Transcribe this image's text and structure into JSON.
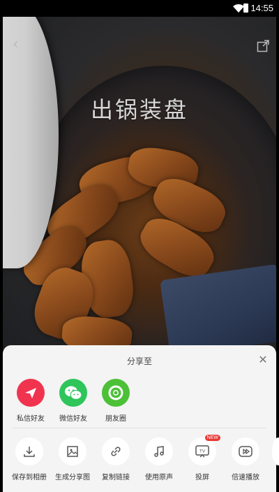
{
  "status_bar": {
    "time": "14:55"
  },
  "video": {
    "caption": "出锅装盘"
  },
  "share_sheet": {
    "title": "分享至",
    "share_targets": [
      {
        "label": "私信好友",
        "icon": "paper-plane-icon",
        "color": "#f0344f"
      },
      {
        "label": "微信好友",
        "icon": "wechat-icon",
        "color": "#2ec55b"
      },
      {
        "label": "朋友圈",
        "icon": "moments-icon",
        "color": "#4cc037"
      }
    ],
    "tools": [
      {
        "label": "保存到相册",
        "icon": "download-icon"
      },
      {
        "label": "生成分享图",
        "icon": "image-icon"
      },
      {
        "label": "复制链接",
        "icon": "link-icon"
      },
      {
        "label": "使用原声",
        "icon": "music-note-icon"
      },
      {
        "label": "投屏",
        "icon": "tv-icon",
        "badge": "NEW"
      },
      {
        "label": "倍速播放",
        "icon": "speed-play-icon"
      }
    ]
  }
}
